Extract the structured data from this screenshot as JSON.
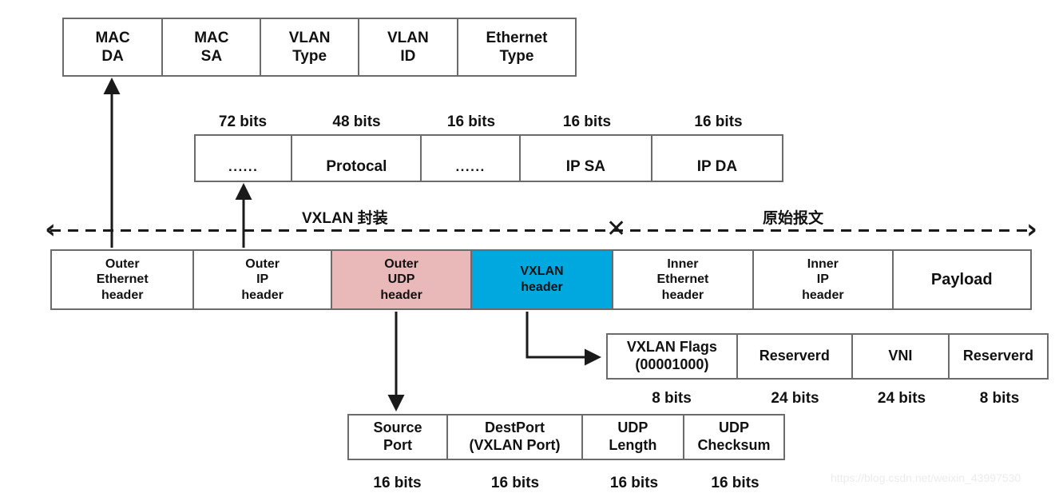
{
  "diagram": {
    "title": "VXLAN packet encapsulation format",
    "colors": {
      "udp_fill": "#e9b8b8",
      "vxlan_fill": "#00a8e0",
      "border": "#6b6b6b",
      "text": "#111111",
      "watermark": "#ececec"
    }
  },
  "mac_row": {
    "cells": [
      {
        "line1": "MAC",
        "line2": "DA"
      },
      {
        "line1": "MAC",
        "line2": "SA"
      },
      {
        "line1": "VLAN",
        "line2": "Type"
      },
      {
        "line1": "VLAN",
        "line2": "ID"
      },
      {
        "line1": "Ethernet",
        "line2": "Type"
      }
    ]
  },
  "ip_row": {
    "cells": [
      {
        "label": "......"
      },
      {
        "label": "Protocal"
      },
      {
        "label": "......"
      },
      {
        "label": "IP  SA"
      },
      {
        "label": "IP  DA"
      }
    ],
    "bits": [
      "72 bits",
      "48 bits",
      "16 bits",
      "16 bits",
      "16 bits"
    ]
  },
  "span": {
    "left_label": "VXLAN 封装",
    "right_label": "原始报文",
    "left_arrow": "‹",
    "right_arrow": "›",
    "divider": "✕"
  },
  "packet_row": {
    "cells": [
      {
        "line1": "Outer",
        "line2": "Ethernet",
        "line3": "header",
        "fill": "#ffffff"
      },
      {
        "line1": "Outer",
        "line2": "IP",
        "line3": "header",
        "fill": "#ffffff"
      },
      {
        "line1": "Outer",
        "line2": "UDP",
        "line3": "header",
        "fill": "#e9b8b8"
      },
      {
        "line1": "VXLAN",
        "line2": "header",
        "line3": "",
        "fill": "#00a8e0"
      },
      {
        "line1": "Inner",
        "line2": "Ethernet",
        "line3": "header",
        "fill": "#ffffff"
      },
      {
        "line1": "Inner",
        "line2": "IP",
        "line3": "header",
        "fill": "#ffffff"
      },
      {
        "line1": "Payload",
        "line2": "",
        "line3": "",
        "fill": "#ffffff"
      }
    ]
  },
  "vxlan_detail_row": {
    "cells": [
      {
        "line1": "VXLAN Flags",
        "line2": "(00001000)"
      },
      {
        "line1": "Reserverd",
        "line2": ""
      },
      {
        "line1": "VNI",
        "line2": ""
      },
      {
        "line1": "Reserverd",
        "line2": ""
      }
    ],
    "bits": [
      "8 bits",
      "24 bits",
      "24 bits",
      "8 bits"
    ]
  },
  "udp_detail_row": {
    "cells": [
      {
        "line1": "Source",
        "line2": "Port"
      },
      {
        "line1": "DestPort",
        "line2": "(VXLAN Port)"
      },
      {
        "line1": "UDP",
        "line2": "Length"
      },
      {
        "line1": "UDP",
        "line2": "Checksum"
      }
    ],
    "bits": [
      "16 bits",
      "16 bits",
      "16 bits",
      "16 bits"
    ]
  },
  "watermark": {
    "text": "https://blog.csdn.net/weixin_43997530"
  }
}
